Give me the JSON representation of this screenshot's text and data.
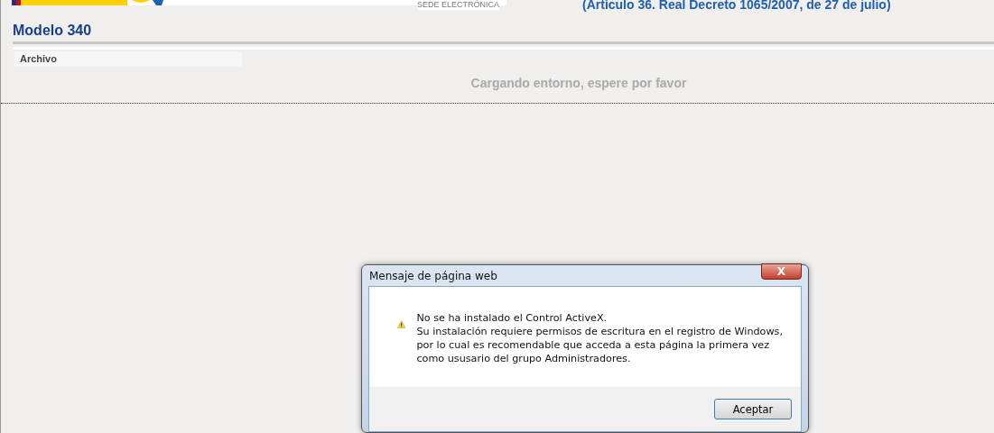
{
  "header": {
    "sede_label": "SEDE ELECTRÓNICA",
    "legal_reference": "(Artículo 36. Real Decreto 1065/2007, de 27 de julio)"
  },
  "page_title": "Modelo 340",
  "menu": [
    "Archivo"
  ],
  "loading_message": "Cargando entorno, espere por favor",
  "dialog": {
    "title": "Mensaje de página web",
    "close": "X",
    "message_lines": [
      "No se ha instalado el Control ActiveX.",
      "Su instalación requiere permisos de escritura en el registro de Windows,",
      "por lo cual es recomendable que acceda a esta página la primera vez",
      "como ususario del grupo Administradores."
    ],
    "buttons": [
      "Aceptar"
    ]
  }
}
